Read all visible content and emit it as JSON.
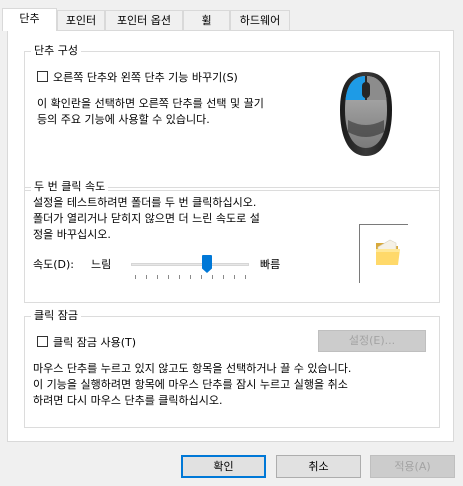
{
  "tabs": [
    "단추",
    "포인터",
    "포인터 옵션",
    "휠",
    "하드웨어"
  ],
  "button_config": {
    "title": "단추 구성",
    "swap_label": "오른쪽 단추와 왼쪽 단추 기능 바꾸기(S)",
    "swap_checked": false,
    "description_line1": "이 확인란을 선택하면 오른쪽 단추를 선택 및 끌기",
    "description_line2": "등의 주요 기능에 사용할 수 있습니다."
  },
  "double_click": {
    "title": "두 번 클릭 속도",
    "description_line1": "설정을 테스트하려면 폴더를 두 번 클릭하십시오.",
    "description_line2": "폴더가 열리거나 닫히지 않으면 더 느린 속도로 설",
    "description_line3": "정을 바꾸십시오.",
    "speed_label": "속도(D):",
    "slow_label": "느림",
    "fast_label": "빠름",
    "speed_value_fraction": 0.65,
    "test_folder_icon": "folder-icon"
  },
  "click_lock": {
    "title": "클릭 잠금",
    "enable_label": "클릭 잠금 사용(T)",
    "enabled": false,
    "settings_button": "설정(E)...",
    "description_line1": "마우스 단추를 누르고 있지 않고도 항목을 선택하거나 끌 수 있습니다.",
    "description_line2": "이 기능을 실행하려면 항목에 마우스 단추를 잠시 누르고 실행을 취소",
    "description_line3": "하려면 다시 마우스 단추를 클릭하십시오."
  },
  "footer": {
    "ok": "확인",
    "cancel": "취소",
    "apply": "적용(A)"
  },
  "colors": {
    "accent": "#0078d7",
    "mouse_highlight": "#1e9be6"
  }
}
